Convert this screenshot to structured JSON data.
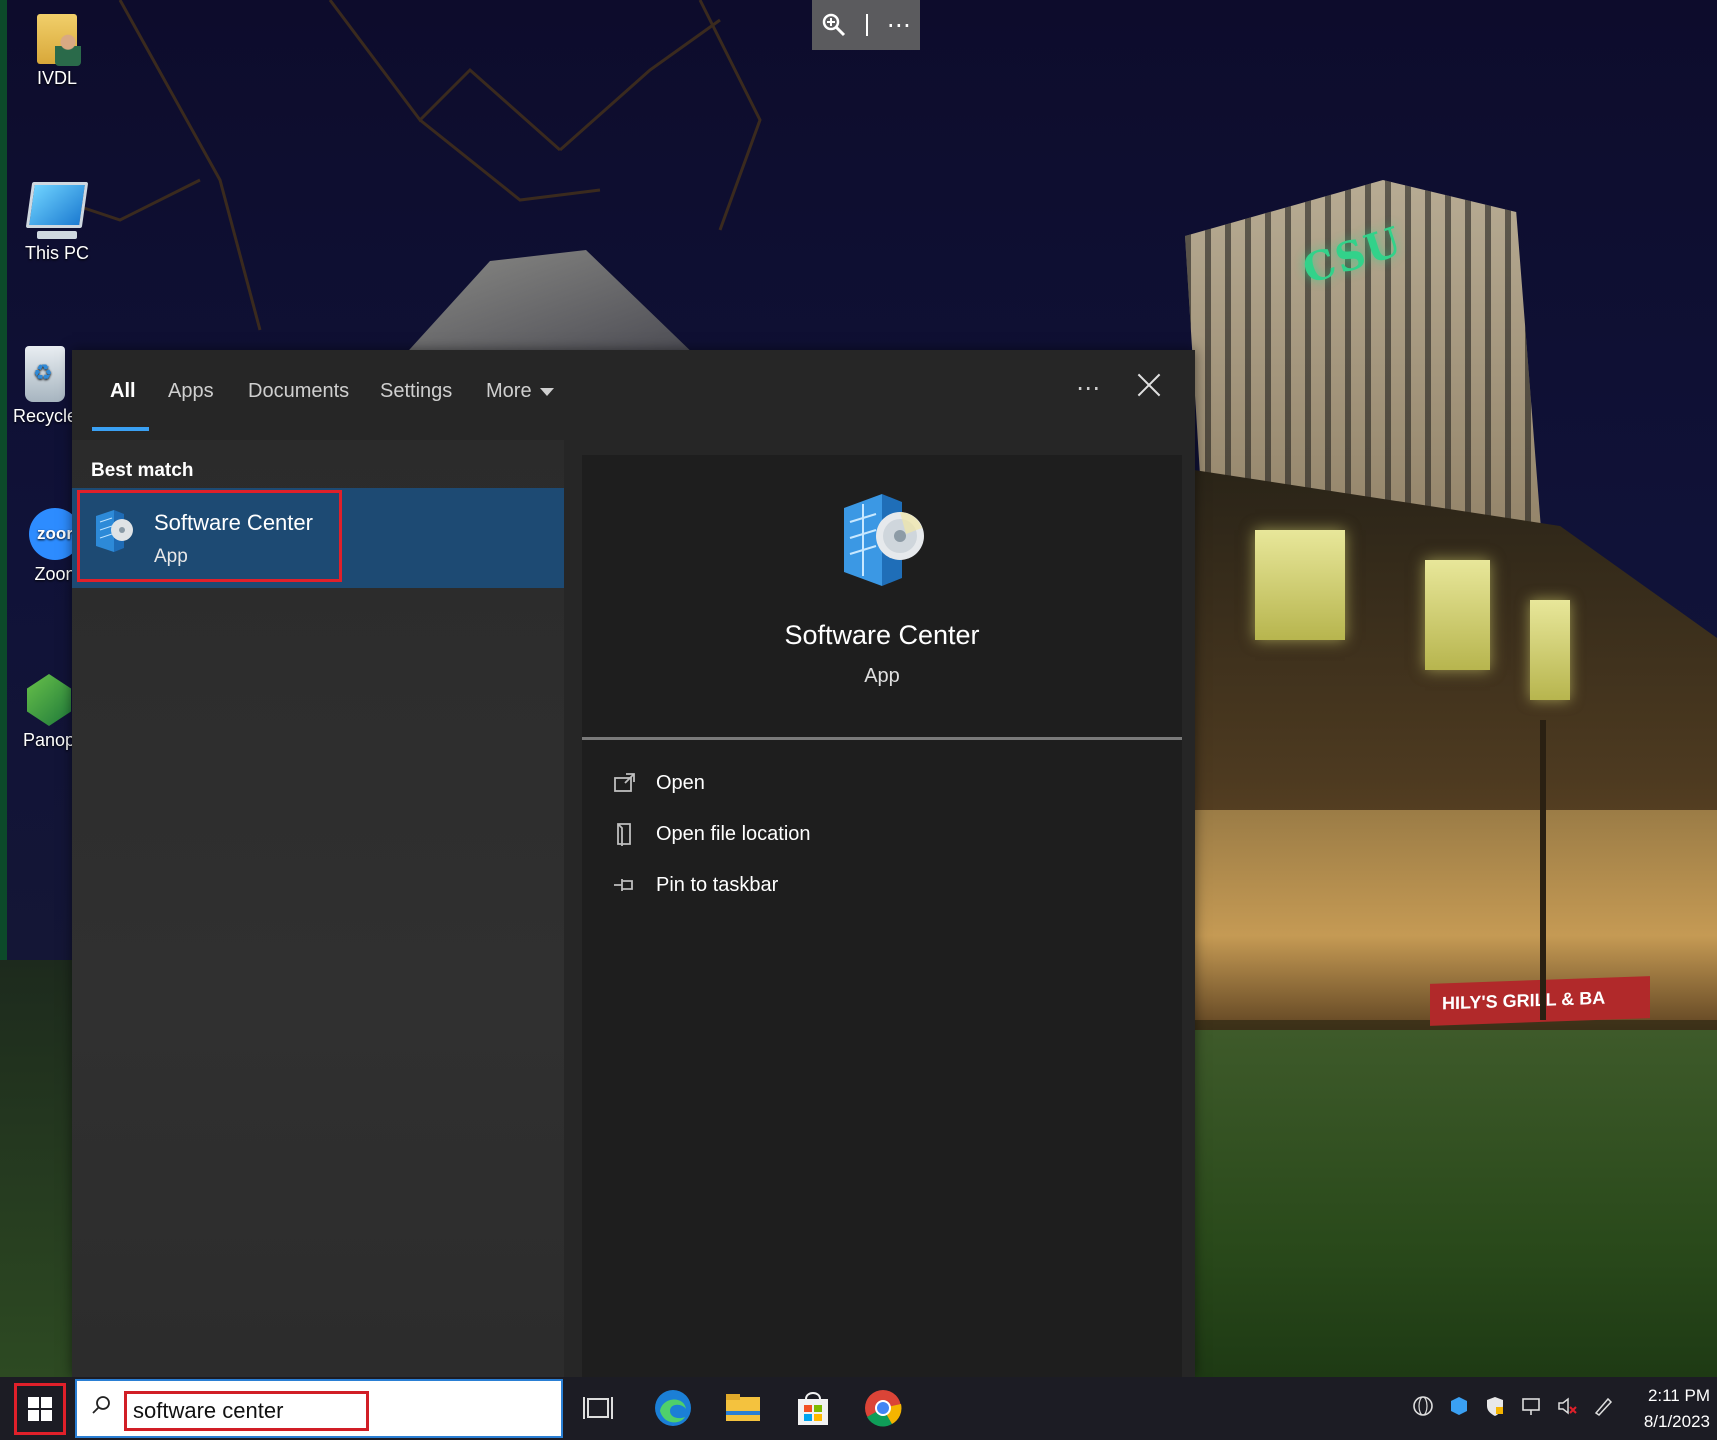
{
  "desktop": {
    "icons": [
      {
        "label": "IVDL",
        "icon": "folder-user-icon"
      },
      {
        "label": "This PC",
        "icon": "computer-icon"
      },
      {
        "label": "Recycle",
        "icon": "recycle-bin-icon"
      },
      {
        "label": "Zoon",
        "icon": "zoom-app-icon",
        "glyph_text": "zoor"
      },
      {
        "label": "Panop",
        "icon": "panopto-icon"
      }
    ],
    "wallpaper": {
      "sign_text": "CSU",
      "banner_text": "HILY'S GRILL & BA"
    }
  },
  "zoom_toolbar": {
    "zoom_icon": "magnify-plus-icon",
    "more_label": "⋯"
  },
  "search_flyout": {
    "tabs": [
      {
        "label": "All",
        "active": true
      },
      {
        "label": "Apps"
      },
      {
        "label": "Documents"
      },
      {
        "label": "Settings"
      },
      {
        "label": "More"
      }
    ],
    "more_options_label": "⋯",
    "best_match_heading": "Best match",
    "best_match": {
      "title": "Software Center",
      "subtitle": "App",
      "icon": "software-center-icon"
    },
    "preview": {
      "title": "Software Center",
      "subtitle": "App",
      "actions": [
        {
          "label": "Open",
          "icon": "open-icon"
        },
        {
          "label": "Open file location",
          "icon": "file-location-icon"
        },
        {
          "label": "Pin to taskbar",
          "icon": "pin-icon"
        }
      ]
    }
  },
  "taskbar": {
    "search_value": "software center",
    "apps": [
      "task-view-icon",
      "edge-icon",
      "file-explorer-icon",
      "store-icon",
      "chrome-icon"
    ],
    "tray_icons": [
      "network-globe-icon",
      "security-icon",
      "shield-icon",
      "display-icon",
      "volume-muted-icon",
      "pen-icon"
    ],
    "time": "2:11 PM",
    "date": "8/1/2023"
  },
  "colors": {
    "accent": "#3aa0f3",
    "highlight_box": "#e0202a",
    "selected_result": "#1d4a73"
  }
}
